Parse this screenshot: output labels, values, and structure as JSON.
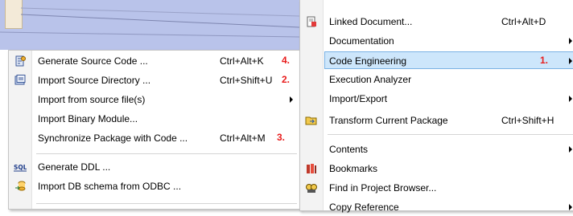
{
  "left_menu": {
    "items": [
      {
        "label": "Generate Source Code ...",
        "shortcut": "Ctrl+Alt+K",
        "num": "4.",
        "icon": "generate-code-icon"
      },
      {
        "label": "Import Source Directory ...",
        "shortcut": "Ctrl+Shift+U",
        "num": "2.",
        "icon": "import-directory-icon"
      },
      {
        "label": "Import from source file(s)",
        "shortcut": "",
        "num": "",
        "submenu": true,
        "icon": ""
      },
      {
        "label": "Import Binary Module...",
        "shortcut": "",
        "num": "",
        "icon": ""
      },
      {
        "label": "Synchronize Package with Code ...",
        "shortcut": "Ctrl+Alt+M",
        "num": "3.",
        "icon": ""
      },
      {
        "label": "Generate DDL ...",
        "shortcut": "",
        "num": "",
        "icon": "sql-icon"
      },
      {
        "label": "Import DB schema from ODBC ...",
        "shortcut": "",
        "num": "",
        "icon": "odbc-import-icon"
      }
    ]
  },
  "right_menu": {
    "items": [
      {
        "label": "Linked Document...",
        "shortcut": "Ctrl+Alt+D",
        "icon": "linked-document-icon"
      },
      {
        "label": "Documentation",
        "submenu": true
      },
      {
        "label": "Code Engineering",
        "num": "1.",
        "submenu": true,
        "highlighted": true
      },
      {
        "label": "Execution Analyzer"
      },
      {
        "label": "Import/Export",
        "submenu": true
      },
      {
        "label": "Transform Current Package",
        "shortcut": "Ctrl+Shift+H",
        "icon": "transform-package-icon"
      },
      {
        "label": "Contents",
        "submenu": true
      },
      {
        "label": "Bookmarks",
        "icon": "bookmark-icon"
      },
      {
        "label": "Find in Project Browser...",
        "icon": "find-browser-icon"
      },
      {
        "label": "Copy Reference",
        "submenu": true
      }
    ]
  },
  "colors": {
    "accent_number": "#e81c1c",
    "highlight_bg": "#cde6fb",
    "highlight_border": "#7ab2e4",
    "canvas": "#b9c3ea"
  }
}
